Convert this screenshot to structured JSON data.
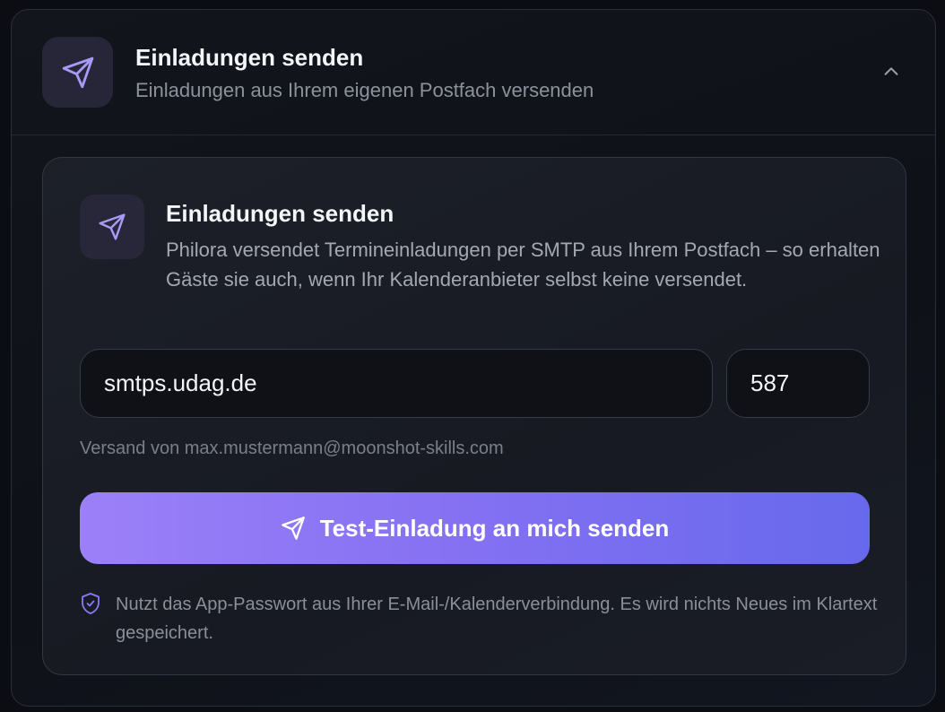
{
  "header": {
    "title": "Einladungen senden",
    "subtitle": "Einladungen aus Ihrem eigenen Postfach versenden",
    "icon": "send-icon",
    "chevron_icon": "chevron-up-icon"
  },
  "card": {
    "icon": "send-icon",
    "title": "Einladungen senden",
    "description": "Philora versendet Termineinladungen per SMTP aus Ihrem Postfach – so erhalten Gäste sie auch, wenn Ihr Kalenderanbieter selbst keine versendet.",
    "smtp_host": "smtps.udag.de",
    "smtp_port": "587",
    "sender_note": "Versand von max.mustermann@moonshot-skills.com",
    "test_button_label": "Test-Einladung an mich senden",
    "test_button_icon": "send-icon",
    "security_icon": "shield-check-icon",
    "security_note": "Nutzt das App-Passwort aus Ihrer E-Mail-/Kalenderverbindung. Es wird nichts Neues im Klartext gespeichert."
  },
  "colors": {
    "accent": "#8b7bf5",
    "button_gradient_start": "#9b80f8",
    "button_gradient_end": "#6769ec",
    "background": "#0b0d12",
    "card_background": "#1b1e27"
  }
}
